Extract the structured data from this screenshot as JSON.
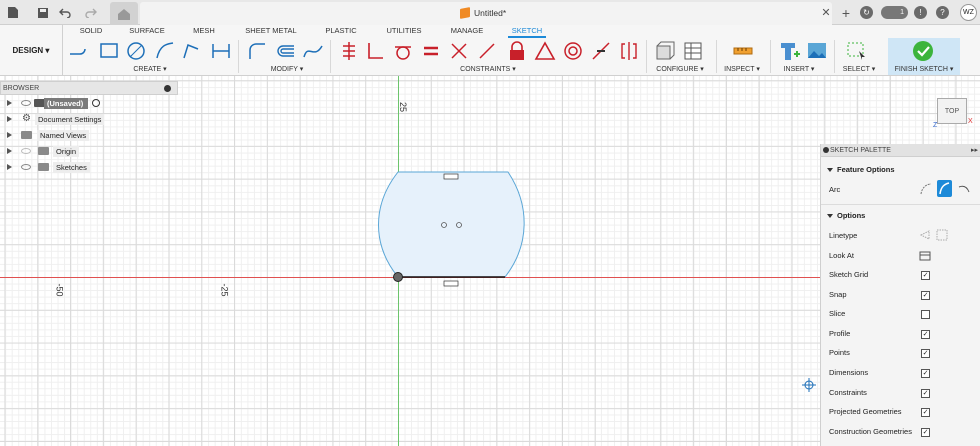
{
  "title_bar": {
    "document_title": "Untitled*",
    "notification_count": "1",
    "user_initials": "WZ"
  },
  "workspace": {
    "label": "DESIGN ▾"
  },
  "tabs": [
    "SOLID",
    "SURFACE",
    "MESH",
    "SHEET METAL",
    "PLASTIC",
    "UTILITIES",
    "MANAGE",
    "SKETCH"
  ],
  "active_tab": "SKETCH",
  "ribbon_groups": {
    "create": "CREATE ▾",
    "modify": "MODIFY ▾",
    "constraints": "CONSTRAINTS ▾",
    "configure": "CONFIGURE ▾",
    "inspect": "INSPECT ▾",
    "insert": "INSERT ▾",
    "select": "SELECT ▾",
    "finish": "FINISH SKETCH ▾"
  },
  "browser": {
    "header": "BROWSER",
    "items": [
      {
        "label": "(Unsaved)"
      },
      {
        "label": "Document Settings"
      },
      {
        "label": "Named Views"
      },
      {
        "label": "Origin"
      },
      {
        "label": "Sketches"
      }
    ]
  },
  "canvas": {
    "vertical_ruler_label": "25",
    "horizontal_labels": [
      "-50",
      "-25"
    ]
  },
  "view_cube": {
    "label": "TOP"
  },
  "palette": {
    "header": "SKETCH PALETTE",
    "feature_options_title": "Feature Options",
    "arc_label": "Arc",
    "options_title": "Options",
    "linetype_label": "Linetype",
    "look_at_label": "Look At",
    "checkbox_rows": [
      {
        "label": "Sketch Grid",
        "checked": true
      },
      {
        "label": "Snap",
        "checked": true
      },
      {
        "label": "Slice",
        "checked": false
      },
      {
        "label": "Profile",
        "checked": true
      },
      {
        "label": "Points",
        "checked": true
      },
      {
        "label": "Dimensions",
        "checked": true
      },
      {
        "label": "Constraints",
        "checked": true
      },
      {
        "label": "Projected Geometries",
        "checked": true
      },
      {
        "label": "Construction Geometries",
        "checked": true
      }
    ]
  },
  "colors": {
    "accent": "#1d8ad8",
    "finish_green": "#3cb43c",
    "sketch_fill": "#e6f1fb",
    "sketch_stroke": "#5aa6d6",
    "constraint_red": "#c8202a"
  }
}
